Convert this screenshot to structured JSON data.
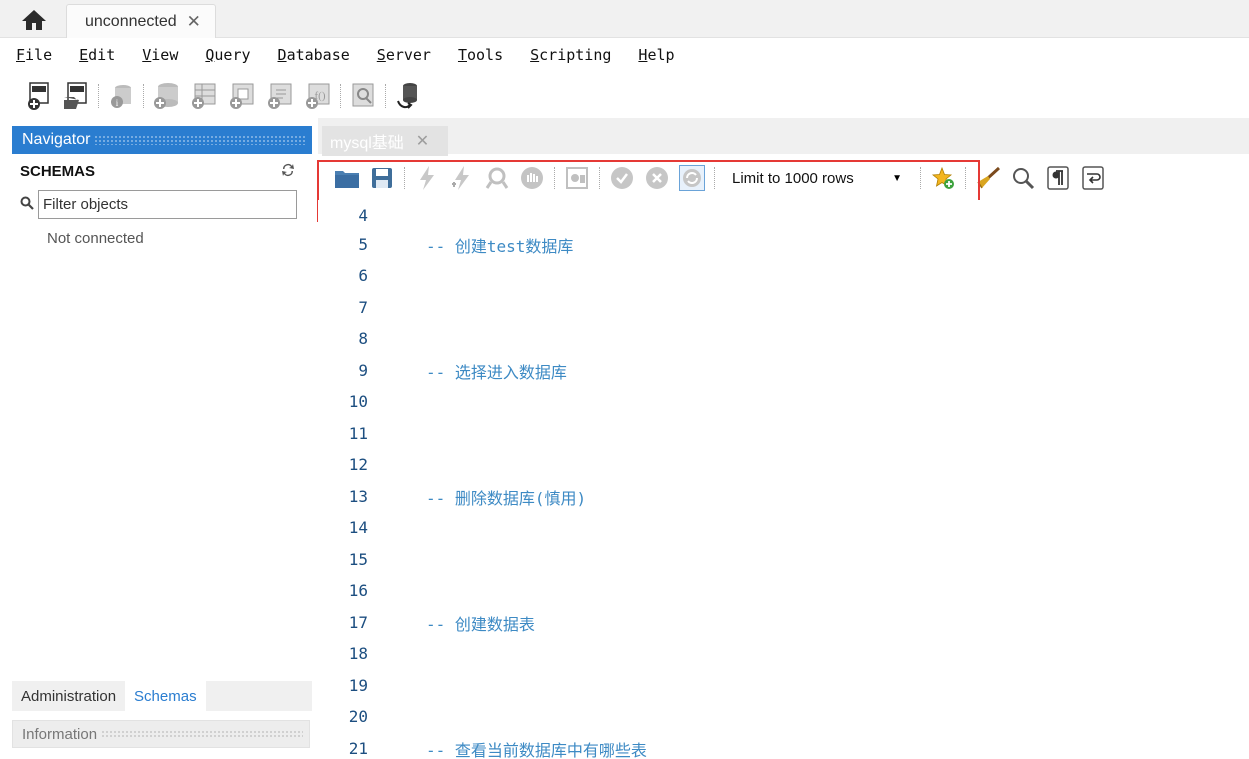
{
  "tabs": {
    "connection_tab_label": "unconnected",
    "close_glyph": "✕"
  },
  "menu": {
    "items": [
      {
        "first": "F",
        "rest": "ile"
      },
      {
        "first": "E",
        "rest": "dit"
      },
      {
        "first": "V",
        "rest": "iew"
      },
      {
        "first": "Q",
        "rest": "uery"
      },
      {
        "first": "D",
        "rest": "atabase"
      },
      {
        "first": "S",
        "rest": "erver"
      },
      {
        "first": "T",
        "rest": "ools"
      },
      {
        "first": "S",
        "rest": "cripting"
      },
      {
        "first": "H",
        "rest": "elp"
      }
    ]
  },
  "navigator": {
    "title": "Navigator",
    "schemas_label": "SCHEMAS",
    "filter_placeholder": "Filter objects",
    "status": "Not connected",
    "bottom_tabs": [
      "Administration",
      "Schemas"
    ],
    "info_title": "Information"
  },
  "editor": {
    "tab_label": "mysql基础",
    "close_glyph": "✕",
    "limit_label": "Limit to 1000 rows",
    "lines": [
      {
        "n": "4",
        "text": ""
      },
      {
        "n": "5",
        "text": "-- 创建test数据库"
      },
      {
        "n": "6",
        "text": ""
      },
      {
        "n": "7",
        "text": ""
      },
      {
        "n": "8",
        "text": ""
      },
      {
        "n": "9",
        "text": "-- 选择进入数据库"
      },
      {
        "n": "10",
        "text": ""
      },
      {
        "n": "11",
        "text": ""
      },
      {
        "n": "12",
        "text": ""
      },
      {
        "n": "13",
        "text": "-- 删除数据库(慎用)"
      },
      {
        "n": "14",
        "text": ""
      },
      {
        "n": "15",
        "text": ""
      },
      {
        "n": "16",
        "text": ""
      },
      {
        "n": "17",
        "text": "-- 创建数据表"
      },
      {
        "n": "18",
        "text": ""
      },
      {
        "n": "19",
        "text": ""
      },
      {
        "n": "20",
        "text": ""
      },
      {
        "n": "21",
        "text": "-- 查看当前数据库中有哪些表"
      }
    ]
  },
  "colors": {
    "accent": "#2a7dd0",
    "comment": "#3d8ac4",
    "highlight": "#e53935"
  }
}
